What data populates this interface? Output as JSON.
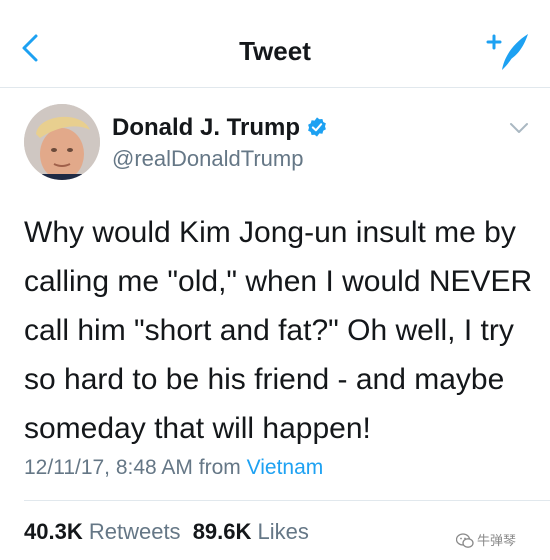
{
  "header": {
    "title": "Tweet",
    "back_icon": "chevron-left-icon",
    "compose_icon": "compose-tweet-icon",
    "accent_color": "#1da1f2"
  },
  "author": {
    "name": "Donald J. Trump",
    "handle": "@realDonaldTrump",
    "verified": true,
    "verified_icon": "verified-badge-icon",
    "menu_icon": "chevron-down-icon"
  },
  "tweet": {
    "lines": [
      "Why would Kim Jong-un insult me by",
      "calling me \"old,\" when I would NEVER",
      "call him \"short and fat?\" Oh well, I try",
      "so hard to be his friend - and maybe",
      "someday that will happen!"
    ],
    "timestamp": "12/11/17, 8:48 AM from",
    "location": "Vietnam"
  },
  "stats": {
    "retweets_count": "40.3K",
    "retweets_label": "Retweets",
    "likes_count": "89.6K",
    "likes_label": "Likes"
  },
  "watermark": {
    "text": "牛弹琴",
    "icon": "wechat-icon"
  }
}
